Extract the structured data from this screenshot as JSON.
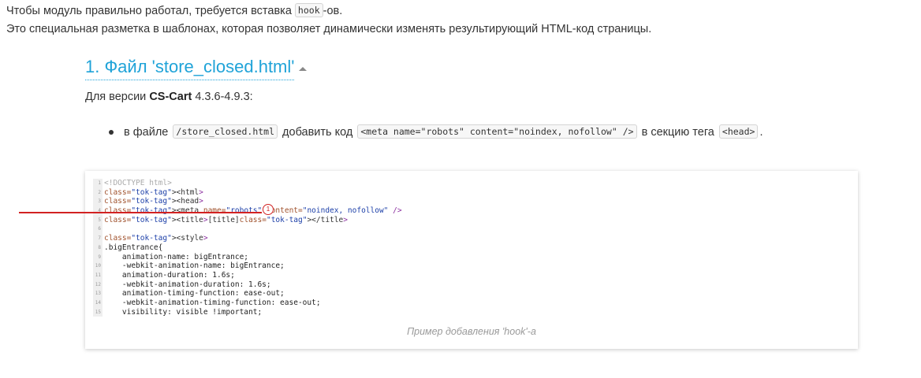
{
  "intro": {
    "line1_before": "Чтобы модуль правильно работал, требуется вставка ",
    "line1_code": "hook",
    "line1_after": "-ов.",
    "line2": "Это специальная разметка в шаблонах, которая позволяет динамически изменять результирующий HTML-код страницы."
  },
  "section": {
    "title": "1. Файл 'store_closed.html'",
    "version_prefix": "Для версии ",
    "version_product": "CS-Cart",
    "version_range": " 4.3.6-4.9.3:",
    "bullet": {
      "text1": "в файле ",
      "code1": "/store_closed.html",
      "text2": " добавить код ",
      "code2": "<meta name=\"robots\" content=\"noindex, nofollow\" />",
      "text3": " в секцию тега ",
      "code3": "<head>",
      "text4": "."
    }
  },
  "figure": {
    "caption": "Пример добавления 'hook'-а",
    "marker": "1",
    "code_lines": [
      {
        "n": "1",
        "text": "<!DOCTYPE html>"
      },
      {
        "n": "2",
        "text": "<html>"
      },
      {
        "n": "3",
        "text": "<head>"
      },
      {
        "n": "4",
        "text": "<meta name=\"robots\" content=\"noindex, nofollow\" />"
      },
      {
        "n": "5",
        "text": "<title>[title]</title>"
      },
      {
        "n": "6",
        "text": ""
      },
      {
        "n": "7",
        "text": "<style>"
      },
      {
        "n": "8",
        "text": ".bigEntrance{"
      },
      {
        "n": "9",
        "text": "    animation-name: bigEntrance;"
      },
      {
        "n": "10",
        "text": "    -webkit-animation-name: bigEntrance;"
      },
      {
        "n": "11",
        "text": "    animation-duration: 1.6s;"
      },
      {
        "n": "12",
        "text": "    -webkit-animation-duration: 1.6s;"
      },
      {
        "n": "13",
        "text": "    animation-timing-function: ease-out;"
      },
      {
        "n": "14",
        "text": "    -webkit-animation-timing-function: ease-out;"
      },
      {
        "n": "15",
        "text": "    visibility: visible !important;"
      }
    ]
  },
  "colors": {
    "heading": "#1fa3d8",
    "highlight": "#d22222"
  }
}
